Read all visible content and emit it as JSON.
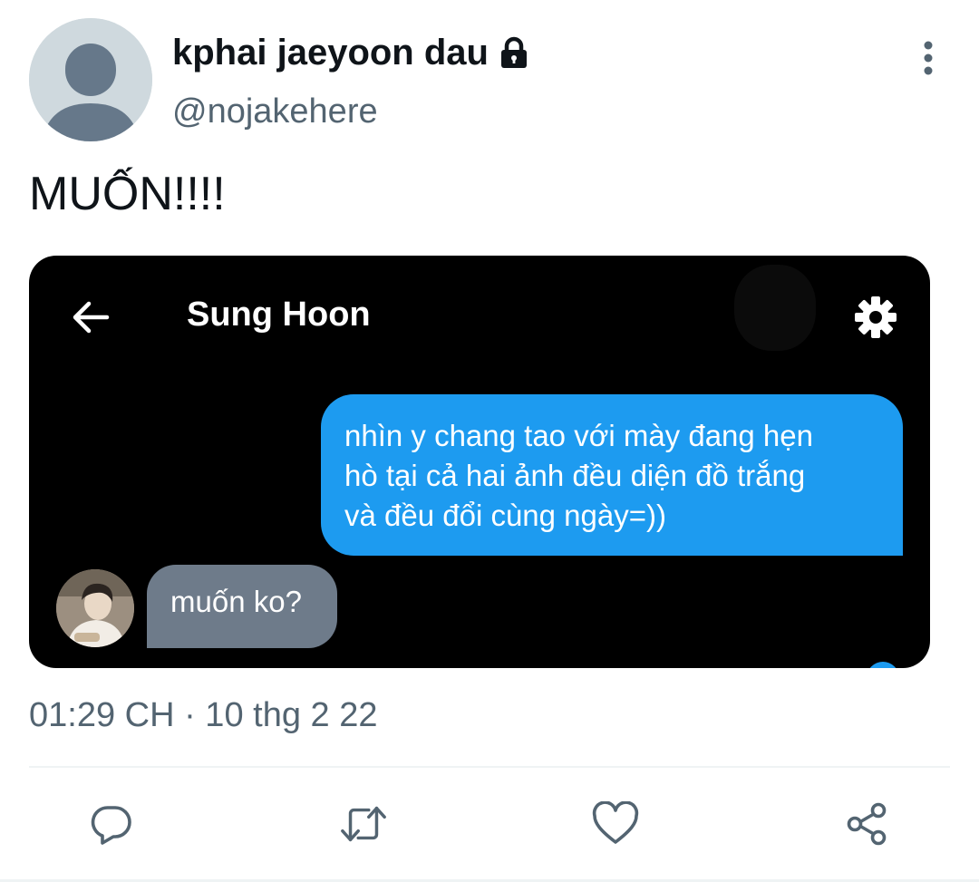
{
  "header": {
    "display_name": "kphai jaeyoon dau",
    "handle": "@nojakehere",
    "avatar_icon": "default-avatar-icon",
    "lock_icon": "lock-icon",
    "more_icon": "more-vertical-icon"
  },
  "tweet": {
    "text": "MUỐN!!!!",
    "timestamp": "01:29 CH · 10 thg 2 22"
  },
  "media": {
    "chat_title": "Sung Hoon",
    "back_icon": "arrow-left-icon",
    "settings_icon": "gear-icon",
    "messages": {
      "outgoing_lines": [
        "nhìn y chang tao với mày đang hẹn",
        "hò tại cả hai ảnh đều diện đồ trắng",
        "và đều đổi cùng ngày=))"
      ],
      "incoming": "muốn ko?"
    }
  },
  "actions": {
    "reply_icon": "reply-icon",
    "retweet_icon": "retweet-icon",
    "like_icon": "heart-icon",
    "share_icon": "share-icon"
  },
  "colors": {
    "accent": "#1d9bf0",
    "secondary_text": "#536471",
    "incoming_bubble": "#6e7b8a"
  }
}
